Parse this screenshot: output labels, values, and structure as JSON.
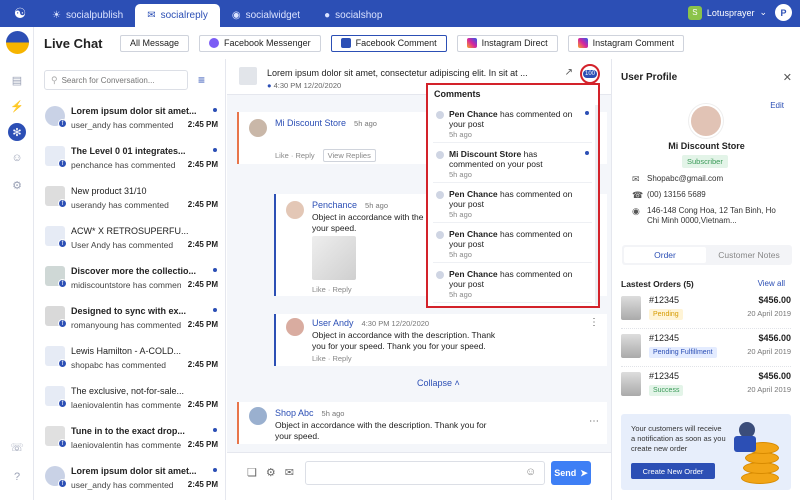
{
  "apptabs": [
    {
      "label": "socialpublish",
      "active": false
    },
    {
      "label": "socialreply",
      "active": true
    },
    {
      "label": "socialwidget",
      "active": false
    },
    {
      "label": "socialshop",
      "active": false
    }
  ],
  "shop_name": "Lotusprayer",
  "user_initial": "P",
  "page_title": "Live Chat",
  "channels": [
    "All Message",
    "Facebook Messenger",
    "Facebook Comment",
    "Instagram Direct",
    "Instagram Comment"
  ],
  "search_placeholder": "Search for Conversation...",
  "conversations": [
    {
      "title": "Lorem ipsum dolor sit amet...",
      "sub": "user_andy has commented",
      "time": "2:45 PM",
      "unread": true
    },
    {
      "title": "The Level 0 01 integrates...",
      "sub": "penchance has commented",
      "time": "2:45 PM",
      "unread": true
    },
    {
      "title": "New product 31/10",
      "sub": "userandy has commented",
      "time": "2:45 PM",
      "unread": false
    },
    {
      "title": "ACW* X RETROSUPERFU...",
      "sub": "User Andy has commented",
      "time": "2:45 PM",
      "unread": false
    },
    {
      "title": "Discover more the collectio...",
      "sub": "midiscountstore has commented",
      "time": "2:45 PM",
      "unread": true
    },
    {
      "title": "Designed to sync with ex...",
      "sub": "romanyoung has commented",
      "time": "2:45 PM",
      "unread": true
    },
    {
      "title": "Lewis Hamilton - A-COLD...",
      "sub": "shopabc has commented",
      "time": "2:45 PM",
      "unread": false
    },
    {
      "title": "The exclusive, not-for-sale...",
      "sub": "laeniovalentin has commented",
      "time": "2:45 PM",
      "unread": false
    },
    {
      "title": "Tune in to the exact drop...",
      "sub": "laeniovalentin has commented",
      "time": "2:45 PM",
      "unread": true
    },
    {
      "title": "Lorem ipsum dolor sit amet...",
      "sub": "user_andy has commented",
      "time": "2:45 PM",
      "unread": true
    }
  ],
  "post": {
    "title": "Lorem ipsum dolor sit amet, consectetur adipiscing elit. In sit at ...",
    "meta": "4:30 PM 12/20/2020",
    "comment_count": "100"
  },
  "thread": {
    "c1": {
      "name": "Mi Discount Store",
      "ago": "5h ago",
      "like": "Like",
      "reply": "Reply",
      "view_replies": "View Replies"
    },
    "c2": {
      "name": "Penchance",
      "ago": "5h ago",
      "text": "Object in accordance with the",
      "text2": "your speed.",
      "like": "Like",
      "reply": "Reply"
    },
    "c3": {
      "name": "User Andy",
      "ago": "4:30 PM 12/20/2020",
      "text": "Object in accordance with the description. Thank",
      "text2": "you for your speed. Thank you for your speed.",
      "like": "Like",
      "reply": "Reply"
    },
    "collapse": "Collapse",
    "c4": {
      "name": "Shop Abc",
      "ago": "5h ago",
      "text": "Object in accordance with the description. Thank you for",
      "text2": "your speed."
    }
  },
  "send_label": "Send",
  "popup": {
    "title": "Comments",
    "items": [
      {
        "name": "Pen Chance",
        "action": "has commented on",
        "tail": "your post",
        "time": "5h ago",
        "unread": true
      },
      {
        "name": "Mi Discount Store",
        "action": "has commented",
        "tail": "on your post",
        "time": "5h ago",
        "unread": true
      },
      {
        "name": "Pen Chance",
        "action": "has commented on",
        "tail": "your post",
        "time": "5h ago",
        "unread": false
      },
      {
        "name": "Pen Chance",
        "action": "has commented on",
        "tail": "your post",
        "time": "5h ago",
        "unread": false
      },
      {
        "name": "Pen Chance",
        "action": "has commented on",
        "tail": "your post",
        "time": "5h ago",
        "unread": false
      }
    ]
  },
  "profile": {
    "title": "User Profile",
    "edit": "Edit",
    "name": "Mi Discount Store",
    "badge": "Subscriber",
    "email": "Shopabc@gmail.com",
    "phone": "(00) 13156 5689",
    "address": "146-148 Cong Hoa, 12 Tan Binh, Ho Chi Minh 0000,Vietnam...",
    "tab_order": "Order",
    "tab_notes": "Customer Notes",
    "orders_heading": "Lastest Orders (5)",
    "view_all": "View all",
    "orders": [
      {
        "number": "#12345",
        "status": "Pending",
        "price": "$456.00",
        "date": "20 April 2019"
      },
      {
        "number": "#12345",
        "status": "Pending Fulfillment",
        "price": "$456.00",
        "date": "20 April 2019"
      },
      {
        "number": "#12345",
        "status": "Success",
        "price": "$456.00",
        "date": "20 April 2019"
      }
    ],
    "promo_text": "Your customers will receive a notification as soon as you create new order",
    "promo_button": "Create New Order"
  }
}
